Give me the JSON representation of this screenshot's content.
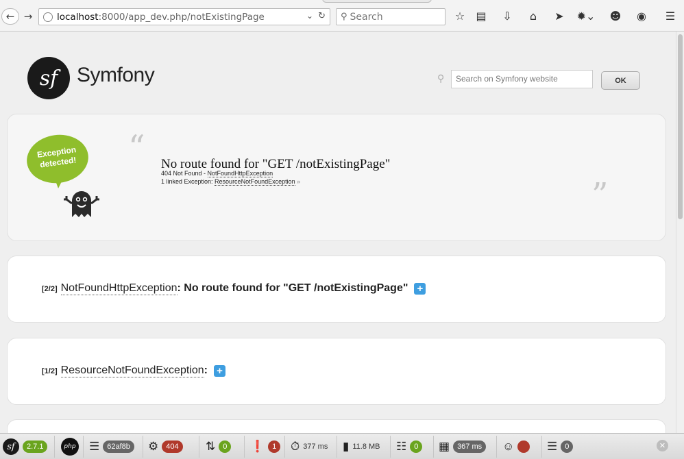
{
  "browser": {
    "url_host": "localhost",
    "url_path": ":8000/app_dev.php/notExistingPage",
    "search_placeholder": "Search",
    "icons": [
      "back-icon",
      "forward-icon",
      "star-icon",
      "reading-list-icon",
      "download-icon",
      "home-icon",
      "send-icon",
      "extension-icon",
      "chat-icon",
      "globe-icon",
      "menu-icon"
    ]
  },
  "header": {
    "brand": "Symfony",
    "logo_glyph": "sf",
    "search_placeholder": "Search on Symfony website",
    "ok_label": "OK"
  },
  "exception": {
    "bubble_line1": "Exception",
    "bubble_line2": "detected!",
    "quote_open": "“",
    "quote_close": "”",
    "title": "No route found for \"GET /notExistingPage\"",
    "status_prefix": "404 Not Found - ",
    "status_class": "NotFoundHttpException",
    "linked_prefix": "1 linked Exception: ",
    "linked_class": "ResourceNotFoundException",
    "raquo": "»"
  },
  "traces": [
    {
      "count": "[2/2]",
      "class_name": "NotFoundHttpException",
      "message": ": No route found for \"GET /notExistingPage\"",
      "toggle": "+"
    },
    {
      "count": "[1/2]",
      "class_name": "ResourceNotFoundException",
      "message": ":",
      "toggle": "+"
    }
  ],
  "profiler": {
    "symfony_version": "2.7.1",
    "php_label": "php",
    "token": "62af8b",
    "status_code": "404",
    "routing_count": "0",
    "errors_count": "1",
    "time": "377 ms",
    "memory": "11.8 MB",
    "logs_count": "0",
    "render_time": "367 ms",
    "db_count": "0",
    "colors": {
      "green": "#6aa41e",
      "red": "#b0392b",
      "grey": "#666666"
    }
  }
}
